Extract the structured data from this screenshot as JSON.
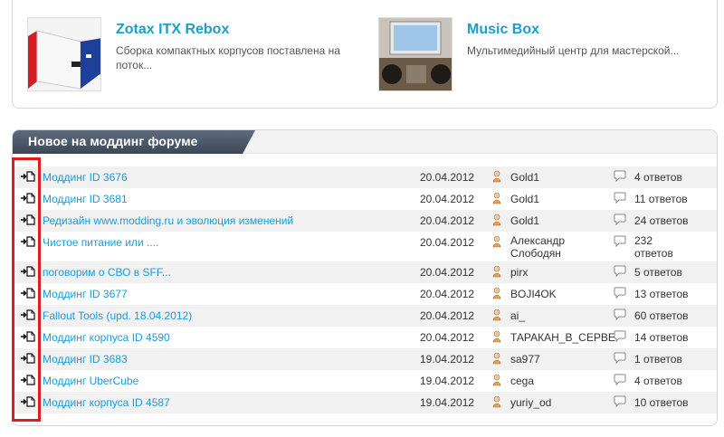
{
  "articles": [
    {
      "title": "Zotax ITX Rebox",
      "description": "Сборка компактных корпусов поставлена на поток..."
    },
    {
      "title": "Music Box",
      "description": "Мультимедийный центр для мастерской..."
    }
  ],
  "forum": {
    "title": "Новое на моддинг форуме",
    "rows": [
      {
        "topic": "Моддинг ID 3676",
        "date": "20.04.2012",
        "user": "Gold1",
        "replies": "4 ответов"
      },
      {
        "topic": "Моддинг ID 3681",
        "date": "20.04.2012",
        "user": "Gold1",
        "replies": "11 ответов"
      },
      {
        "topic": "Редизайн www.modding.ru и эволюция изменений",
        "date": "20.04.2012",
        "user": "Gold1",
        "replies": "24 ответов"
      },
      {
        "topic": "Чистое питание или ....",
        "date": "20.04.2012",
        "user": "Александр Слободян",
        "replies": "232 ответов"
      },
      {
        "topic": "поговорим о СВО в SFF...",
        "date": "20.04.2012",
        "user": "pirx",
        "replies": "5 ответов"
      },
      {
        "topic": "Моддинг ID 3677",
        "date": "20.04.2012",
        "user": "BOJI4OK",
        "replies": "13 ответов"
      },
      {
        "topic": "Fallout Tools (upd. 18.04.2012)",
        "date": "20.04.2012",
        "user": "ai_",
        "replies": "60 ответов"
      },
      {
        "topic": "Моддинг корпуса ID 4590",
        "date": "20.04.2012",
        "user": "ТАРАКАН_В_СЕРВЕРЕ",
        "replies": "14 ответов"
      },
      {
        "topic": "Моддинг ID 3683",
        "date": "19.04.2012",
        "user": "sa977",
        "replies": "1 ответов"
      },
      {
        "topic": "Моддинг UberCube",
        "date": "19.04.2012",
        "user": "cega",
        "replies": "4 ответов"
      },
      {
        "topic": "Моддинг корпуса ID 4587",
        "date": "19.04.2012",
        "user": "yuriy_od",
        "replies": "10 ответов"
      }
    ]
  },
  "colors": {
    "link": "#1a9cd8",
    "header": "#4a5868",
    "highlight": "#e01e1e"
  },
  "icons": {
    "row": "arrow-document-icon",
    "user": "user-icon",
    "replies": "comment-bubble-icon"
  }
}
